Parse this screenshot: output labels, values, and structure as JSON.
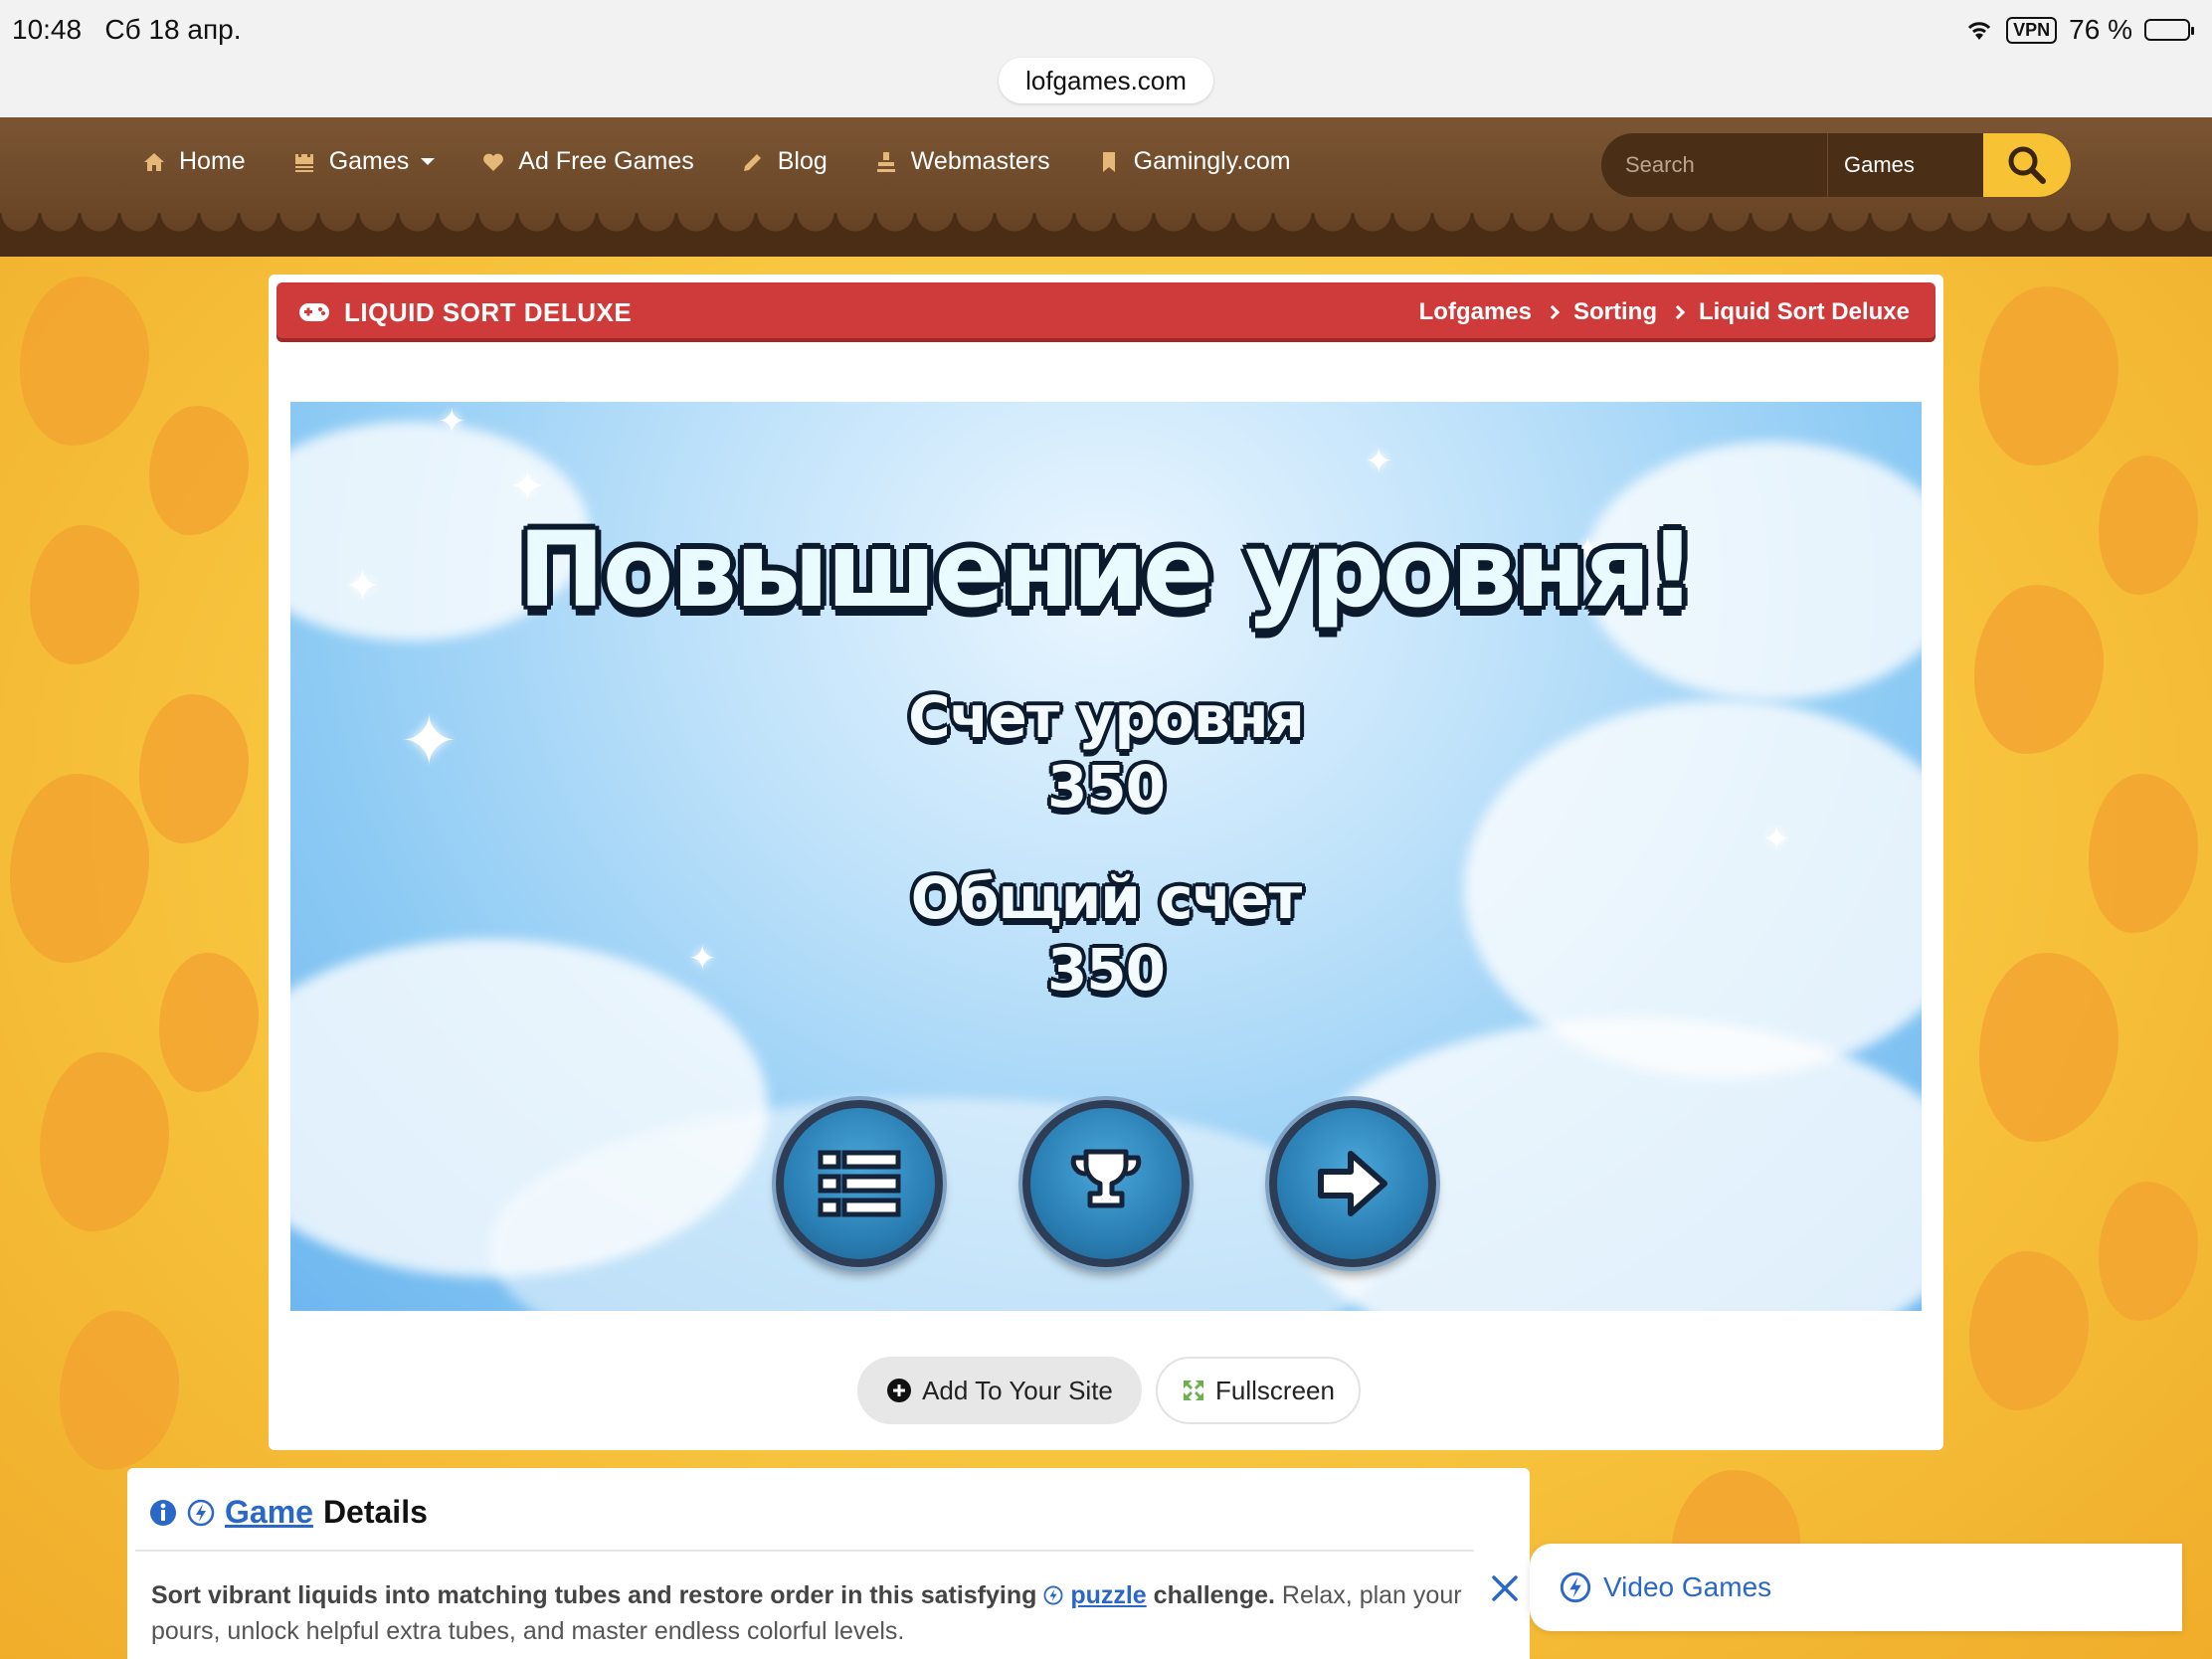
{
  "status_bar": {
    "time": "10:48",
    "date": "Сб 18 апр.",
    "vpn": "VPN",
    "battery": "76 %",
    "battery_level": 0.76
  },
  "browser": {
    "url": "lofgames.com"
  },
  "nav": {
    "items": [
      {
        "label": "Home",
        "icon": "home-icon"
      },
      {
        "label": "Games",
        "icon": "castle-icon",
        "dropdown": true
      },
      {
        "label": "Ad Free Games",
        "icon": "heart-icon"
      },
      {
        "label": "Blog",
        "icon": "pencil-icon"
      },
      {
        "label": "Webmasters",
        "icon": "stamp-icon"
      },
      {
        "label": "Gamingly.com",
        "icon": "bookmark-icon"
      }
    ],
    "search_placeholder": "Search",
    "search_scope": "Games"
  },
  "game_header": {
    "title": "LIQUID SORT DELUXE",
    "breadcrumbs": [
      "Lofgames",
      "Sorting",
      "Liquid Sort Deluxe"
    ]
  },
  "game_screen": {
    "heading": "Повышение уровня!",
    "level_score_label": "Счет уровня",
    "level_score": "350",
    "total_score_label": "Общий счет",
    "total_score": "350",
    "buttons": [
      "menu-list-icon",
      "trophy-icon",
      "next-arrow-icon"
    ]
  },
  "actions": {
    "add_label": "Add To Your Site",
    "fullscreen_label": "Fullscreen"
  },
  "details": {
    "heading_link": "Game",
    "heading_rest": "Details",
    "text_bold_1": "Sort vibrant liquids into matching tubes and restore order in this satisfying",
    "text_link": "puzzle",
    "text_bold_2": "challenge.",
    "text_rest": "Relax, plan your pours, unlock helpful extra tubes, and master endless colorful levels."
  },
  "floating_chip": {
    "label": "Video Games"
  },
  "colors": {
    "nav_brown": "#6a4627",
    "title_red": "#cf3b3b",
    "accent_yellow": "#f7c233",
    "link_blue": "#2a68c8"
  }
}
